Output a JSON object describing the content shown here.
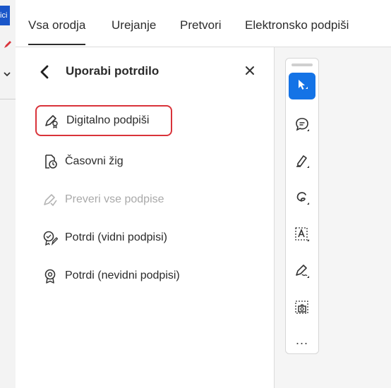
{
  "left_strip": {
    "label": "ici"
  },
  "tabs": [
    {
      "label": "Vsa orodja",
      "active": true
    },
    {
      "label": "Urejanje",
      "active": false
    },
    {
      "label": "Pretvori",
      "active": false
    },
    {
      "label": "Elektronsko podpiši",
      "active": false
    }
  ],
  "panel": {
    "title": "Uporabi potrdilo",
    "items": [
      {
        "label": "Digitalno podpiši",
        "icon": "digital-sign-icon",
        "highlighted": true,
        "disabled": false
      },
      {
        "label": "Časovni žig",
        "icon": "timestamp-icon",
        "highlighted": false,
        "disabled": false
      },
      {
        "label": "Preveri vse podpise",
        "icon": "validate-signatures-icon",
        "highlighted": false,
        "disabled": true
      },
      {
        "label": "Potrdi (vidni podpisi)",
        "icon": "certify-visible-icon",
        "highlighted": false,
        "disabled": false
      },
      {
        "label": "Potrdi (nevidni podpisi)",
        "icon": "certify-invisible-icon",
        "highlighted": false,
        "disabled": false
      }
    ]
  },
  "toolbar": {
    "tools": [
      "select-icon",
      "comment-icon",
      "highlight-icon",
      "draw-icon",
      "text-select-icon",
      "sign-icon",
      "snapshot-icon",
      "more-icon"
    ],
    "more_label": "..."
  },
  "colors": {
    "accent": "#1473e6",
    "highlight_border": "#d9333a",
    "disabled_text": "#a9a9a9"
  }
}
